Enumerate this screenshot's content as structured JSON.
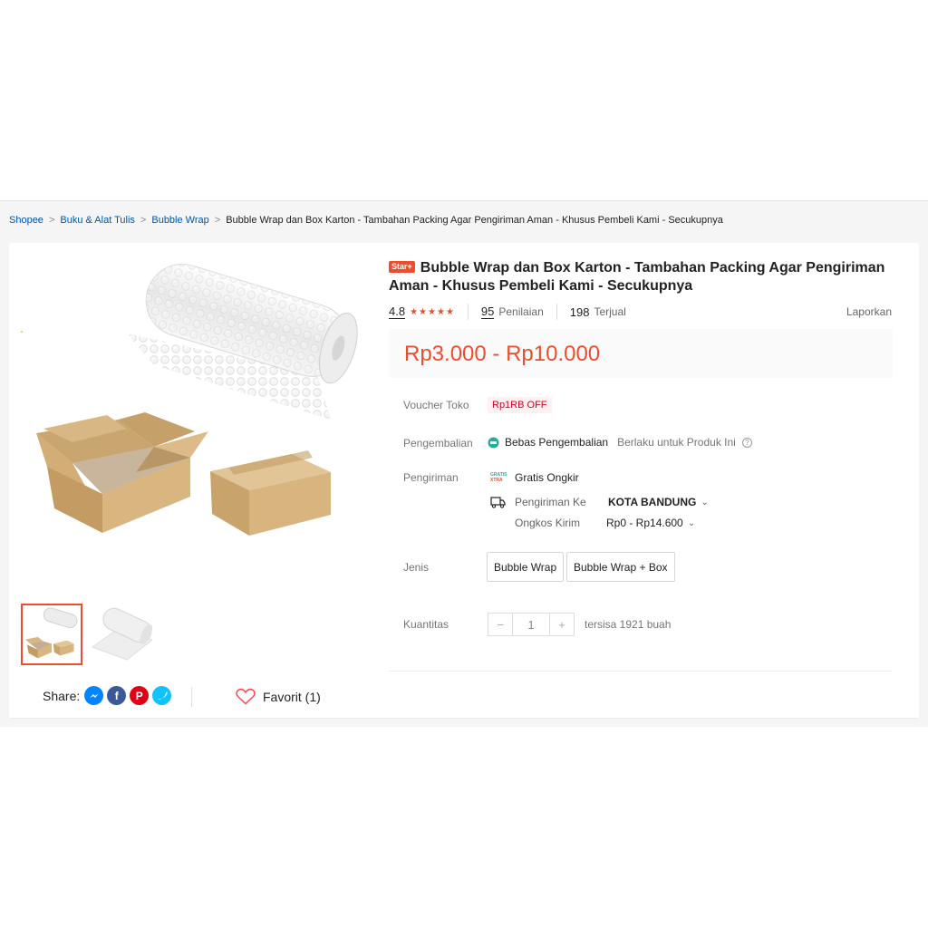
{
  "breadcrumb": {
    "items": [
      "Shopee",
      "Buku & Alat Tulis",
      "Bubble Wrap"
    ],
    "current": "Bubble Wrap dan Box Karton - Tambahan Packing Agar Pengiriman Aman - Khusus Pembeli Kami - Secukupnya"
  },
  "product": {
    "badge": "Star+",
    "title": "Bubble Wrap dan Box Karton - Tambahan Packing Agar Pengiriman Aman - Khusus Pembeli Kami - Secukupnya",
    "rating": "4.8",
    "rating_value": 4.8,
    "review_count": "95",
    "review_label": "Penilaian",
    "sold_count": "198",
    "sold_label": "Terjual",
    "report_label": "Laporkan",
    "price": "Rp3.000 - Rp10.000"
  },
  "voucher": {
    "label": "Voucher Toko",
    "value": "Rp1RB OFF"
  },
  "returns": {
    "label": "Pengembalian",
    "value": "Bebas Pengembalian",
    "note": "Berlaku untuk Produk Ini"
  },
  "shipping": {
    "label": "Pengiriman",
    "free_badge_top": "GRATIS",
    "free_badge_bottom": "XTRA",
    "free": "Gratis Ongkir",
    "to_label": "Pengiriman Ke",
    "to_value": "KOTA BANDUNG",
    "cost_label": "Ongkos Kirim",
    "cost_value": "Rp0 - Rp14.600"
  },
  "variants": {
    "label": "Jenis",
    "options": [
      "Bubble Wrap",
      "Bubble Wrap + Box"
    ]
  },
  "quantity": {
    "label": "Kuantitas",
    "minus": "−",
    "value": "1",
    "plus": "+",
    "stock": "tersisa 1921 buah"
  },
  "share": {
    "label": "Share:"
  },
  "favorite": {
    "label": "Favorit (1)"
  },
  "colors": {
    "accent": "#ee4d2d",
    "link": "#0055aa"
  }
}
